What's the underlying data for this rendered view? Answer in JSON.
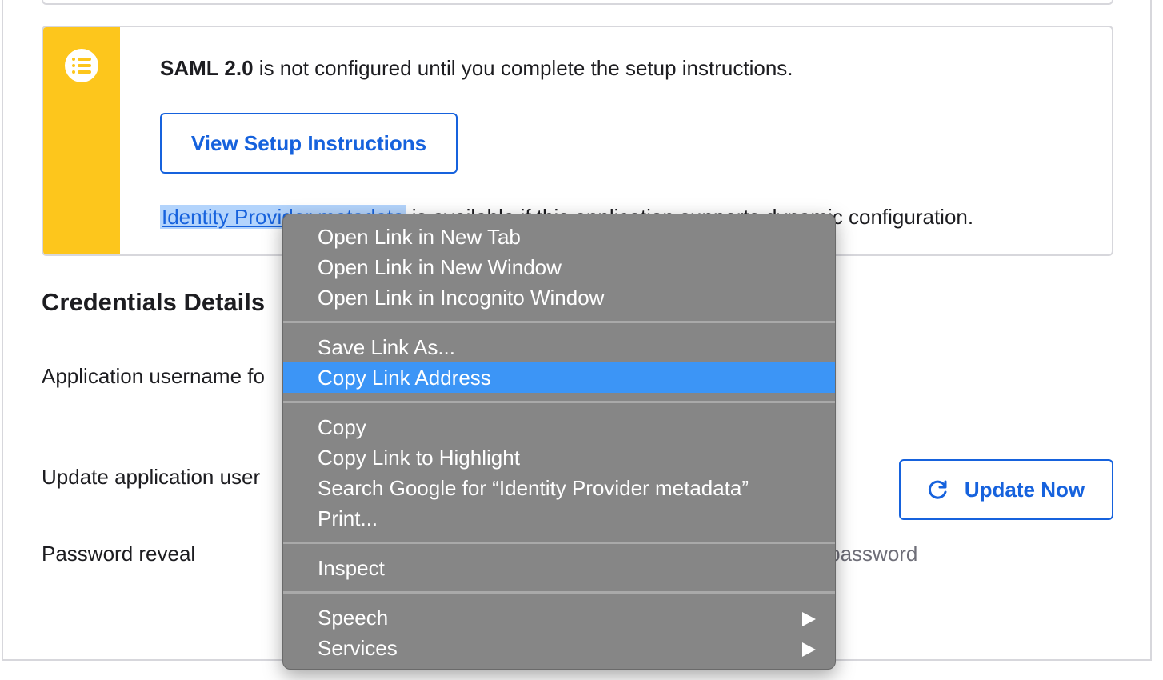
{
  "notice": {
    "product": "SAML 2.0",
    "message": " is not configured until you complete the setup instructions.",
    "setup_button": "View Setup Instructions",
    "metadata_link": "Identity Provider metadata",
    "metadata_tail": " is available if this application supports dynamic configuration.",
    "icon": "list-icon",
    "accent_color": "#fdc61c"
  },
  "credentials": {
    "title": "Credentials Details",
    "username_label": "Application username fo",
    "update_label": "Update application user",
    "update_button": "Update Now",
    "update_icon": "refresh-icon",
    "reveal_label": "Password reveal",
    "reveal_tail": "eir password"
  },
  "context_menu": {
    "groups": [
      [
        "Open Link in New Tab",
        "Open Link in New Window",
        "Open Link in Incognito Window"
      ],
      [
        "Save Link As...",
        "Copy Link Address"
      ],
      [
        "Copy",
        "Copy Link to Highlight",
        "Search Google for “Identity Provider metadata”",
        "Print..."
      ],
      [
        "Inspect"
      ],
      [
        "Speech",
        "Services"
      ]
    ],
    "highlighted": "Copy Link Address",
    "highlight_color": "#3c95f6"
  }
}
